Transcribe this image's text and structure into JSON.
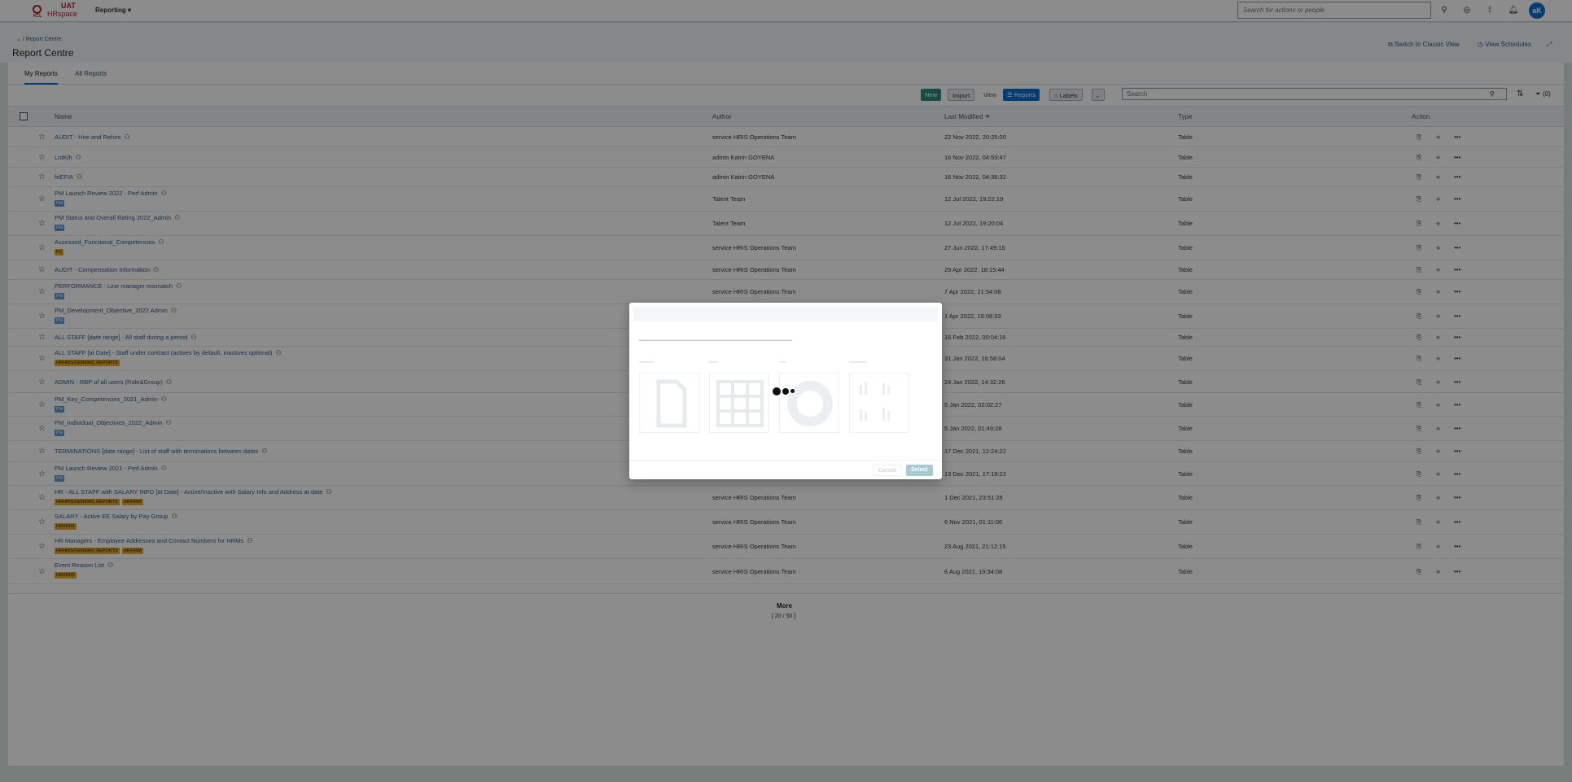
{
  "shell": {
    "logo_kcl": "KCL",
    "logo_uat": "UAT",
    "logo_product": "HRspace",
    "menu": "Reporting",
    "search_placeholder": "Search for actions or people",
    "avatar_initials": "aK"
  },
  "header": {
    "breadcrumb": "/ Report Centre",
    "title": "Report Centre",
    "switch_classic": "Switch to Classic View",
    "view_schedules": "View Schedules"
  },
  "tabs": [
    "My Reports",
    "All Reports"
  ],
  "toolbar": {
    "new_label": "New",
    "import_label": "Import",
    "view_label": "View",
    "reports_label": "Reports",
    "labels_label": "Labels",
    "search_placeholder": "Search",
    "filter_count": "(0)"
  },
  "columns": {
    "name": "Name",
    "author": "Author",
    "last_modified": "Last Modified",
    "type": "Type",
    "action": "Action"
  },
  "rows": [
    {
      "name": "AUDIT - Hire and Rehire",
      "tags": [],
      "author": "service HRIS Operations Team",
      "modified": "22 Nov 2022, 20:25:00",
      "type": "Table"
    },
    {
      "name": "LrdKlh",
      "tags": [],
      "author": "admin Katrin GOYENA",
      "modified": "16 Nov 2022, 04:53:47",
      "type": "Table"
    },
    {
      "name": "feEFIA",
      "tags": [],
      "author": "admin Katrin GOYENA",
      "modified": "16 Nov 2022, 04:38:32",
      "type": "Table"
    },
    {
      "name": "PM Launch Review 2022 - Perf Admin",
      "tags": [
        {
          "t": "PM",
          "c": "blue"
        }
      ],
      "author": "Talent Team",
      "modified": "12 Jul 2022, 19:22:19",
      "type": "Table"
    },
    {
      "name": "PM Status and Overall Rating 2022_Admin",
      "tags": [
        {
          "t": "PM",
          "c": "blue"
        }
      ],
      "author": "Talent Team",
      "modified": "12 Jul 2022, 19:20:04",
      "type": "Table"
    },
    {
      "name": "Assessed_Functional_Competencies",
      "tags": [
        {
          "t": "FC",
          "c": "amber"
        }
      ],
      "author": "service HRIS Operations Team",
      "modified": "27 Jun 2022, 17:49:15",
      "type": "Table"
    },
    {
      "name": "AUDIT - Compensation Information",
      "tags": [],
      "author": "service HRIS Operations Team",
      "modified": "29 Apr 2022, 18:15:44",
      "type": "Table"
    },
    {
      "name": "PERFORMANCE - Line manager mismatch",
      "tags": [
        {
          "t": "PM",
          "c": "blue"
        }
      ],
      "author": "service HRIS Operations Team",
      "modified": "7 Apr 2022, 21:54:08",
      "type": "Table"
    },
    {
      "name": "PM_Development_Objective_2022 Admin",
      "tags": [
        {
          "t": "PM",
          "c": "blue"
        }
      ],
      "author": "",
      "modified": "1 Apr 2022, 19:08:33",
      "type": "Table"
    },
    {
      "name": "ALL STAFF [date range] - All staff during a period",
      "tags": [],
      "author": "",
      "modified": "16 Feb 2022, 00:04:16",
      "type": "Table"
    },
    {
      "name": "ALL STAFF [at Date] - Staff under contract (actives by default, inactives optional)",
      "tags": [
        {
          "t": "HRHRIS/GENERIC REPORTS",
          "c": "amber"
        }
      ],
      "author": "",
      "modified": "31 Jan 2022, 16:58:04",
      "type": "Table"
    },
    {
      "name": "ADMIN - RBP of all users (Role&Group)",
      "tags": [],
      "author": "",
      "modified": "24 Jan 2022, 14:32:26",
      "type": "Table"
    },
    {
      "name": "PM_Key_Competencies_2021_Admin",
      "tags": [
        {
          "t": "PM",
          "c": "blue"
        }
      ],
      "author": "",
      "modified": "5 Jan 2022, 02:02:27",
      "type": "Table"
    },
    {
      "name": "PM_Individual_Objectives_2022_Admin",
      "tags": [
        {
          "t": "PM",
          "c": "blue"
        }
      ],
      "author": "",
      "modified": "5 Jan 2022, 01:49:28",
      "type": "Table"
    },
    {
      "name": "TERMINATIONS [date range] - List of staff with terminations between dates",
      "tags": [],
      "author": "",
      "modified": "17 Dec 2021, 12:24:22",
      "type": "Table"
    },
    {
      "name": "PM Launch Review 2021 - Perf Admin",
      "tags": [
        {
          "t": "PM",
          "c": "blue"
        }
      ],
      "author": "service HRIS Operations Team",
      "modified": "13 Dec 2021, 17:19:22",
      "type": "Table"
    },
    {
      "name": "HR - ALL STAFF with SALARY INFO [at Date] - Active/Inactive with Salary Info and Address at date",
      "tags": [
        {
          "t": "HRHRIS/GENERIC REPORTS",
          "c": "amber"
        },
        {
          "t": "HR/HRM",
          "c": "amber"
        }
      ],
      "author": "service HRIS Operations Team",
      "modified": "1 Dec 2021, 23:51:28",
      "type": "Table"
    },
    {
      "name": "SALARY - Active EE Salary by Pay Group",
      "tags": [
        {
          "t": "HR/HRIS",
          "c": "amber"
        }
      ],
      "author": "service HRIS Operations Team",
      "modified": "6 Nov 2021, 01:11:06",
      "type": "Table"
    },
    {
      "name": "HR Managers - Employee Addresses and Contact Numbers for HRMs",
      "tags": [
        {
          "t": "HRHRIS/GENERIC REPORTS",
          "c": "amber"
        },
        {
          "t": "HR/HRM",
          "c": "amber"
        }
      ],
      "author": "service HRIS Operations Team",
      "modified": "23 Aug 2021, 21:12:15",
      "type": "Table"
    },
    {
      "name": "Event Reason List",
      "tags": [
        {
          "t": "HR/HRIS",
          "c": "amber"
        }
      ],
      "author": "service HRIS Operations Team",
      "modified": "6 Aug 2021, 19:34:08",
      "type": "Table"
    }
  ],
  "footer": {
    "more_label": "More",
    "count": "[ 20 / 50 ]"
  },
  "dialog": {
    "cancel_label": "Cancel",
    "select_label": "Select"
  }
}
